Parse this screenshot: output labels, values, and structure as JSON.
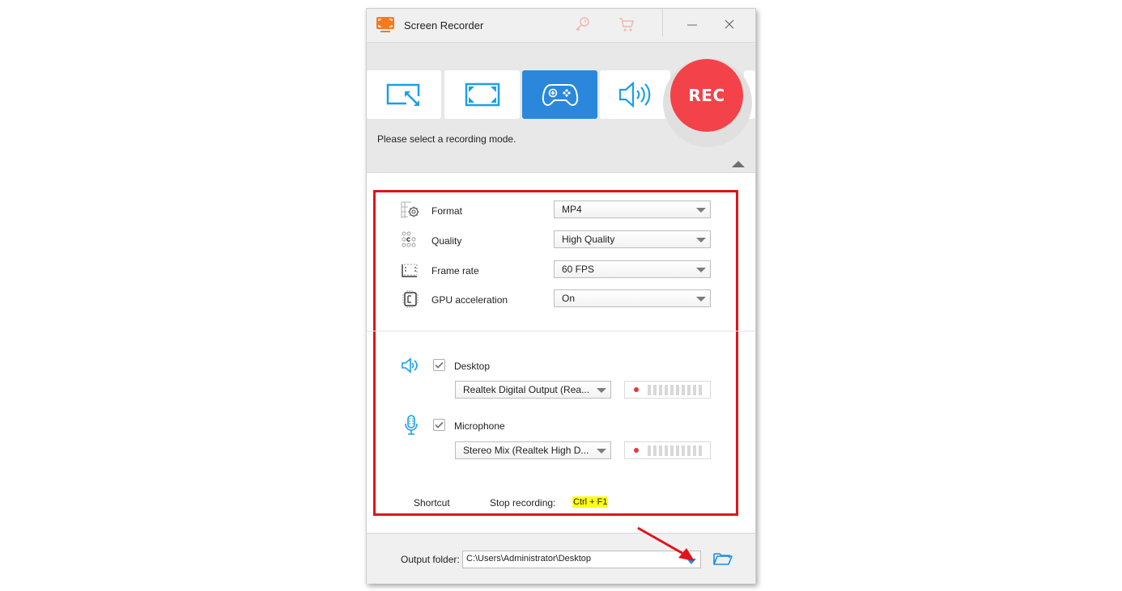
{
  "window": {
    "title": "Screen Recorder",
    "titlebar_icons": [
      "key-icon",
      "cart-icon",
      "minimize-icon",
      "close-icon"
    ]
  },
  "modes": {
    "tabs": [
      {
        "name": "custom-region",
        "icon": "region-resize-icon",
        "active": false
      },
      {
        "name": "fullscreen",
        "icon": "fullscreen-icon",
        "active": false
      },
      {
        "name": "game",
        "icon": "gamepad-icon",
        "active": true
      },
      {
        "name": "audio-only",
        "icon": "speaker-icon",
        "active": false
      }
    ],
    "rec_label": "REC",
    "hint": "Please select a recording mode.",
    "accent_color": "#2a87dc",
    "rec_color": "#f4424a"
  },
  "settings": {
    "rows": [
      {
        "label": "Format",
        "icon": "format-gear-icon",
        "value": "MP4"
      },
      {
        "label": "Quality",
        "icon": "quality-dots-icon",
        "value": "High Quality"
      },
      {
        "label": "Frame rate",
        "icon": "frame-rate-icon",
        "value": "60 FPS"
      },
      {
        "label": "GPU acceleration",
        "icon": "chip-icon",
        "value": "On"
      }
    ]
  },
  "audio": {
    "desktop": {
      "label": "Desktop",
      "checked": true,
      "device": "Realtek Digital Output (Rea...",
      "meter_bars": 10
    },
    "microphone": {
      "label": "Microphone",
      "checked": true,
      "device": "Stereo Mix (Realtek High D...",
      "meter_bars": 10
    }
  },
  "shortcut": {
    "label": "Shortcut",
    "action": "Stop recording:",
    "hotkey": "Ctrl + F1"
  },
  "output": {
    "label": "Output folder:",
    "path": "C:\\Users\\Administrator\\Desktop"
  }
}
